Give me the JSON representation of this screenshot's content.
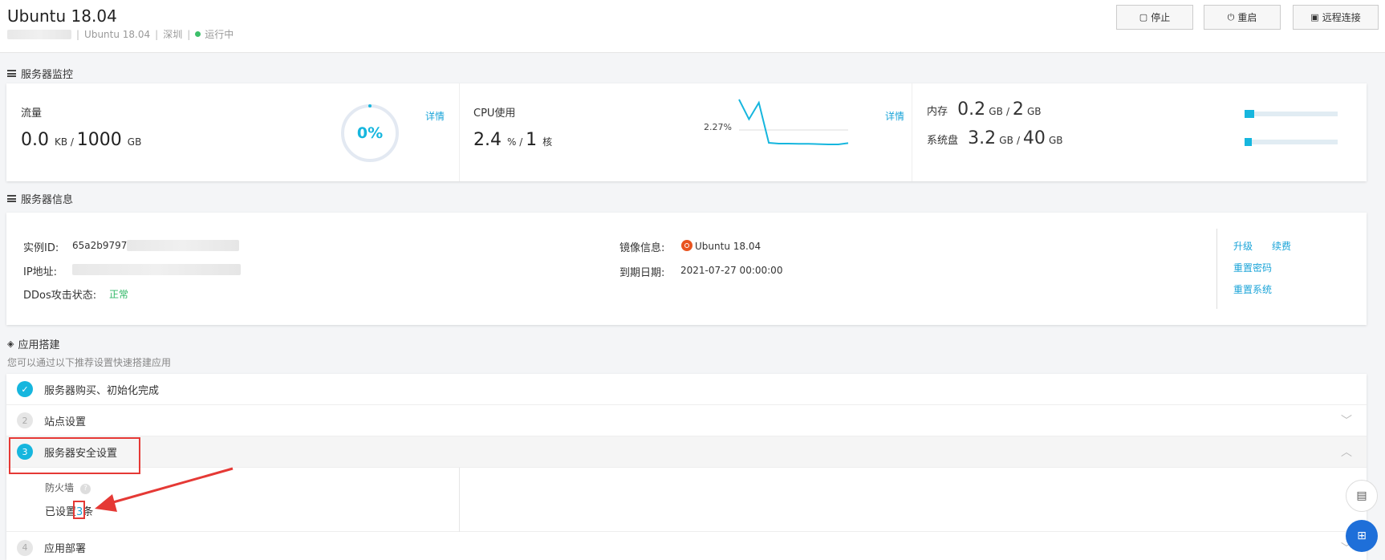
{
  "header": {
    "title": "Ubuntu 18.04",
    "os": "Ubuntu 18.04",
    "region": "深圳",
    "status": "运行中",
    "buttons": {
      "stop": "停止",
      "restart": "重启",
      "remote": "远程连接"
    }
  },
  "monitor": {
    "section_title": "服务器监控",
    "traffic": {
      "label": "流量",
      "used": "0.0",
      "used_unit": "KB",
      "total": "1000",
      "total_unit": "GB",
      "percent_label": "0%",
      "detail": "详情"
    },
    "cpu": {
      "label": "CPU使用",
      "used": "2.4",
      "used_unit": "%",
      "cores": "1",
      "cores_unit": "核",
      "peak_label": "2.27%",
      "detail": "详情"
    },
    "memory": {
      "label": "内存",
      "used": "0.2",
      "used_unit": "GB",
      "total": "2",
      "total_unit": "GB",
      "fraction": 0.1
    },
    "disk": {
      "label": "系统盘",
      "used": "3.2",
      "used_unit": "GB",
      "total": "40",
      "total_unit": "GB",
      "fraction": 0.08
    }
  },
  "info": {
    "section_title": "服务器信息",
    "instance_id_label": "实例ID:",
    "instance_id_value": "65a2b9797",
    "ip_label": "IP地址:",
    "ddos_label": "DDos攻击状态:",
    "ddos_value": "正常",
    "image_label": "镜像信息:",
    "image_value": "Ubuntu 18.04",
    "expire_label": "到期日期:",
    "expire_value": "2021-07-27 00:00:00",
    "actions": {
      "upgrade": "升级",
      "renew": "续费",
      "reset_password": "重置密码",
      "reset_system": "重置系统"
    }
  },
  "apps": {
    "section_title": "应用搭建",
    "subtitle": "您可以通过以下推荐设置快速搭建应用",
    "steps": [
      {
        "num": "✓",
        "label": "服务器购买、初始化完成"
      },
      {
        "num": "2",
        "label": "站点设置"
      },
      {
        "num": "3",
        "label": "服务器安全设置"
      },
      {
        "num": "4",
        "label": "应用部署"
      }
    ],
    "firewall": {
      "label": "防火墙",
      "help": "?",
      "set_prefix": "已设置",
      "count": "3",
      "set_suffix": "条"
    }
  },
  "chart_data": {
    "type": "line",
    "values": [
      3.5,
      2.27,
      3.3,
      0.8,
      0.75,
      0.75,
      0.74,
      0.74,
      0.72,
      0.7,
      0.7,
      0.78
    ]
  }
}
